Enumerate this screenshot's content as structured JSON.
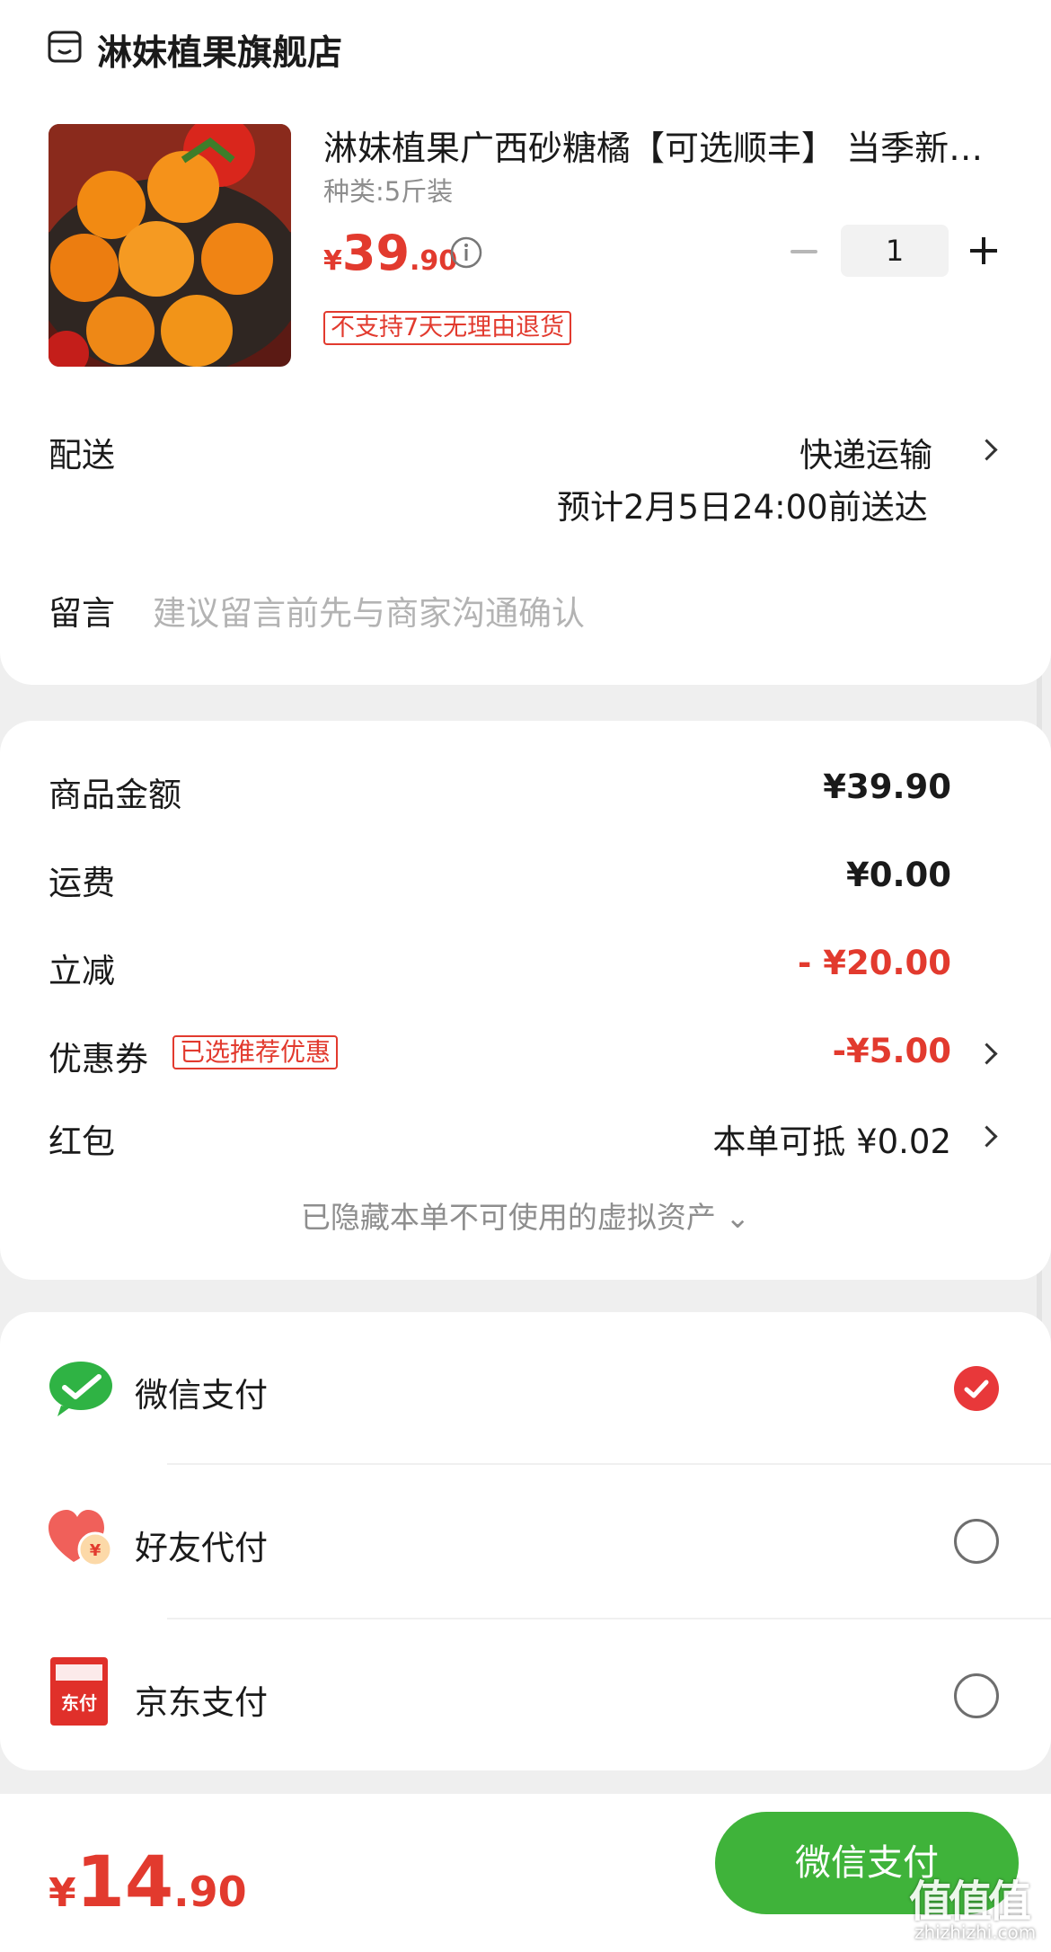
{
  "store": {
    "name": "淋妹植果旗舰店",
    "icon": "store-icon"
  },
  "product": {
    "title": "淋妹植果广西砂糖橘【可选顺丰】 当季新鲜水果",
    "spec": "种类:5斤装",
    "price_currency": "¥",
    "price_int": "39",
    "price_dec": ".90",
    "quantity": "1",
    "tag": "不支持7天无理由退货"
  },
  "delivery": {
    "label": "配送",
    "method": "快递运输",
    "eta": "预计2月5日24:00前送达"
  },
  "message": {
    "label": "留言",
    "placeholder": "建议留言前先与商家沟通确认"
  },
  "summary": {
    "goods_label": "商品金额",
    "goods_value": "¥39.90",
    "shipping_label": "运费",
    "shipping_value": "¥0.00",
    "discount_label": "立减",
    "discount_value": "- ¥20.00",
    "coupon_label": "优惠券",
    "coupon_tag": "已选推荐优惠",
    "coupon_value": "-¥5.00",
    "redpacket_label": "红包",
    "redpacket_value": "本单可抵 ¥0.02",
    "hidden_assets": "已隐藏本单不可使用的虚拟资产 ⌄"
  },
  "payment": {
    "methods": [
      {
        "label": "微信支付",
        "icon": "wechat-pay-icon",
        "selected": true
      },
      {
        "label": "好友代付",
        "icon": "friend-pay-icon",
        "selected": false
      },
      {
        "label": "京东支付",
        "icon": "jd-pay-icon",
        "selected": false
      }
    ]
  },
  "footer": {
    "total_currency": "¥",
    "total_int": "14",
    "total_dec": ".90",
    "pay_button": "微信支付"
  },
  "watermark": {
    "text": "值值值",
    "url": "zhizhizhi.com"
  },
  "colors": {
    "accent_red": "#e23a2e",
    "wechat_green": "#3fb33a",
    "background": "#efefef"
  }
}
